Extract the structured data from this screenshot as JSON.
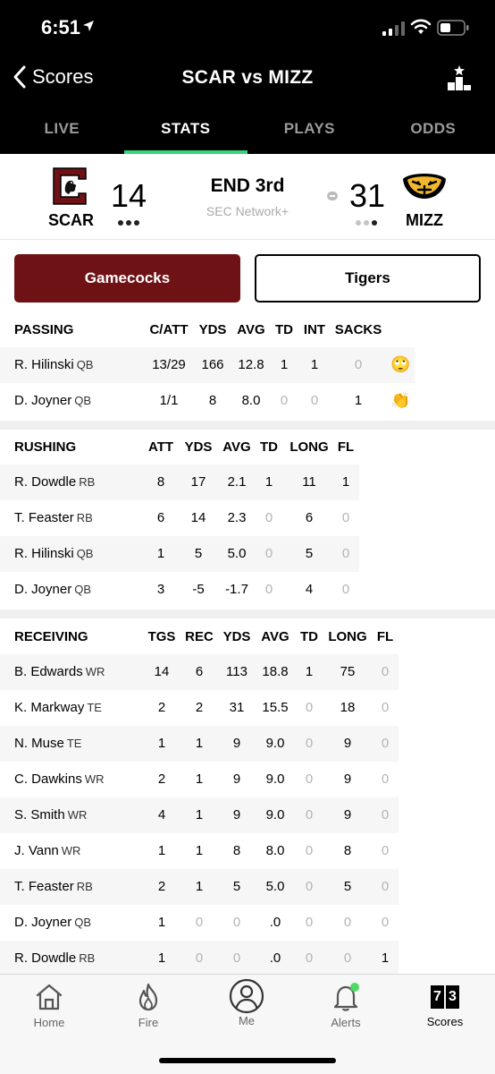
{
  "status": {
    "time": "6:51"
  },
  "nav": {
    "back_label": "Scores",
    "title": "SCAR vs MIZZ"
  },
  "tabs": [
    "LIVE",
    "STATS",
    "PLAYS",
    "ODDS"
  ],
  "game": {
    "home": {
      "abbr": "SCAR",
      "score": "14"
    },
    "away": {
      "abbr": "MIZZ",
      "score": "31"
    },
    "period": "END 3rd",
    "network": "SEC Network+"
  },
  "toggle": {
    "left": "Gamecocks",
    "right": "Tigers"
  },
  "passing": {
    "title": "PASSING",
    "headers": [
      "C/ATT",
      "YDS",
      "AVG",
      "TD",
      "INT",
      "SACKS"
    ],
    "rows": [
      {
        "name": "R. Hilinski",
        "pos": "QB",
        "vals": [
          "13/29",
          "166",
          "12.8",
          "1",
          "1",
          "0"
        ],
        "emoji": "🙄"
      },
      {
        "name": "D. Joyner",
        "pos": "QB",
        "vals": [
          "1/1",
          "8",
          "8.0",
          "0",
          "0",
          "1"
        ],
        "emoji": "👏"
      }
    ]
  },
  "rushing": {
    "title": "RUSHING",
    "headers": [
      "ATT",
      "YDS",
      "AVG",
      "TD",
      "LONG",
      "FL"
    ],
    "rows": [
      {
        "name": "R. Dowdle",
        "pos": "RB",
        "vals": [
          "8",
          "17",
          "2.1",
          "1",
          "11",
          "1"
        ]
      },
      {
        "name": "T. Feaster",
        "pos": "RB",
        "vals": [
          "6",
          "14",
          "2.3",
          "0",
          "6",
          "0"
        ]
      },
      {
        "name": "R. Hilinski",
        "pos": "QB",
        "vals": [
          "1",
          "5",
          "5.0",
          "0",
          "5",
          "0"
        ]
      },
      {
        "name": "D. Joyner",
        "pos": "QB",
        "vals": [
          "3",
          "-5",
          "-1.7",
          "0",
          "4",
          "0"
        ]
      }
    ]
  },
  "receiving": {
    "title": "RECEIVING",
    "headers": [
      "TGS",
      "REC",
      "YDS",
      "AVG",
      "TD",
      "LONG",
      "FL"
    ],
    "rows": [
      {
        "name": "B. Edwards",
        "pos": "WR",
        "vals": [
          "14",
          "6",
          "113",
          "18.8",
          "1",
          "75",
          "0"
        ]
      },
      {
        "name": "K. Markway",
        "pos": "TE",
        "vals": [
          "2",
          "2",
          "31",
          "15.5",
          "0",
          "18",
          "0"
        ]
      },
      {
        "name": "N. Muse",
        "pos": "TE",
        "vals": [
          "1",
          "1",
          "9",
          "9.0",
          "0",
          "9",
          "0"
        ]
      },
      {
        "name": "C. Dawkins",
        "pos": "WR",
        "vals": [
          "2",
          "1",
          "9",
          "9.0",
          "0",
          "9",
          "0"
        ]
      },
      {
        "name": "S. Smith",
        "pos": "WR",
        "vals": [
          "4",
          "1",
          "9",
          "9.0",
          "0",
          "9",
          "0"
        ]
      },
      {
        "name": "J. Vann",
        "pos": "WR",
        "vals": [
          "1",
          "1",
          "8",
          "8.0",
          "0",
          "8",
          "0"
        ]
      },
      {
        "name": "T. Feaster",
        "pos": "RB",
        "vals": [
          "2",
          "1",
          "5",
          "5.0",
          "0",
          "5",
          "0"
        ]
      },
      {
        "name": "D. Joyner",
        "pos": "QB",
        "vals": [
          "1",
          "0",
          "0",
          ".0",
          "0",
          "0",
          "0"
        ]
      },
      {
        "name": "R. Dowdle",
        "pos": "RB",
        "vals": [
          "1",
          "0",
          "0",
          ".0",
          "0",
          "0",
          "1"
        ]
      }
    ]
  },
  "tabbar": [
    {
      "label": "Home",
      "icon": "home-icon"
    },
    {
      "label": "Fire",
      "icon": "fire-icon"
    },
    {
      "label": "Me",
      "icon": "profile-icon"
    },
    {
      "label": "Alerts",
      "icon": "bell-icon"
    },
    {
      "label": "Scores",
      "icon": "scores-icon",
      "digits": [
        "7",
        "3"
      ]
    }
  ],
  "colors": {
    "gamecocks": "#6e1216",
    "accent_green": "#37d67a",
    "alert_dot": "#4cd964"
  }
}
